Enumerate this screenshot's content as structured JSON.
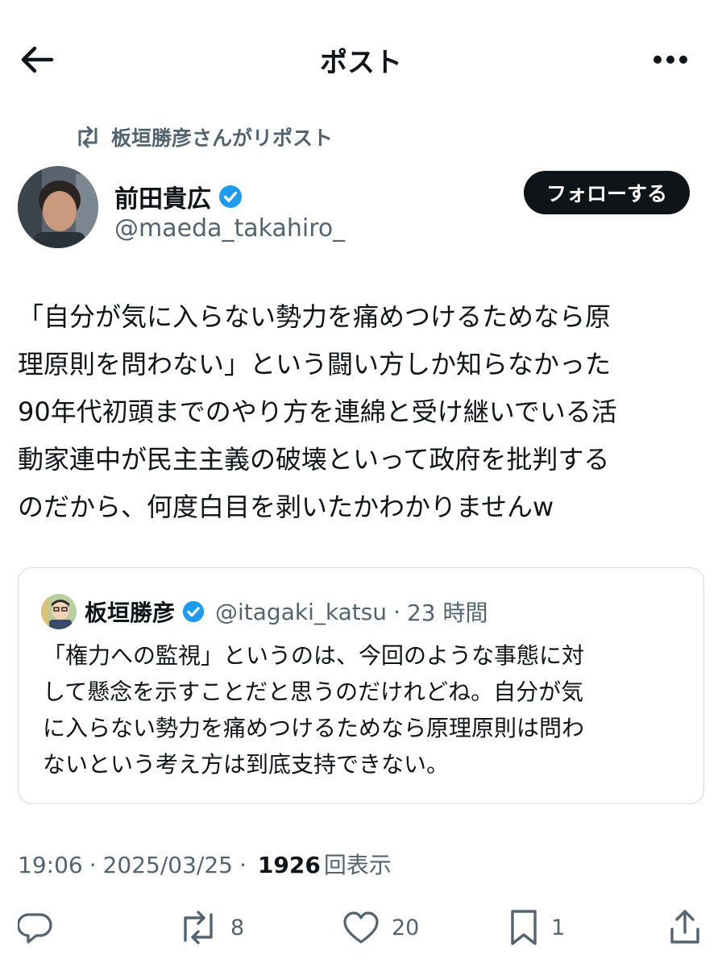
{
  "header": {
    "title": "ポスト",
    "back_icon": "arrow-left-icon",
    "more_icon": "more-horizontal-icon"
  },
  "repost": {
    "label": "板垣勝彦さんがリポスト",
    "icon": "repost-icon"
  },
  "author": {
    "name": "前田貴広",
    "handle": "@maeda_takahiro_",
    "verified": true,
    "follow_label": "フォローする"
  },
  "post": {
    "text": "「自分が気に入らない勢力を痛めつけるためなら原\n理原則を問わない」という闘い方しか知らなかった\n90年代初頭までのやり方を連綿と受け継いでいる活\n動家連中が民主主義の破壊といって政府を批判する\nのだから、何度白目を剥いたかわかりませんw"
  },
  "quote": {
    "name": "板垣勝彦",
    "handle": "@itagaki_katsu",
    "separator": "·",
    "time": "23 時間",
    "verified": true,
    "text": "「権力への監視」というのは、今回のような事態に対\nして懸念を示すことだと思うのだけれどね。自分が気\nに入らない勢力を痛めつけるためなら原理原則は問わ\nないという考え方は到底支持できない。"
  },
  "meta": {
    "time": "19:06",
    "sep1": "·",
    "date": "2025/03/25",
    "sep2": "·",
    "views_count": "1926",
    "views_label": "回表示"
  },
  "actions": {
    "reply": {
      "icon": "reply-icon",
      "count": ""
    },
    "retweet": {
      "icon": "retweet-icon",
      "count": "8"
    },
    "like": {
      "icon": "heart-icon",
      "count": "20"
    },
    "bookmark": {
      "icon": "bookmark-icon",
      "count": "1"
    },
    "share": {
      "icon": "share-icon",
      "count": ""
    }
  },
  "colors": {
    "text": "#0f1419",
    "secondary": "#536471",
    "verified": "#1d9bf0",
    "border": "#cfd9de",
    "button_bg": "#0f1419"
  }
}
